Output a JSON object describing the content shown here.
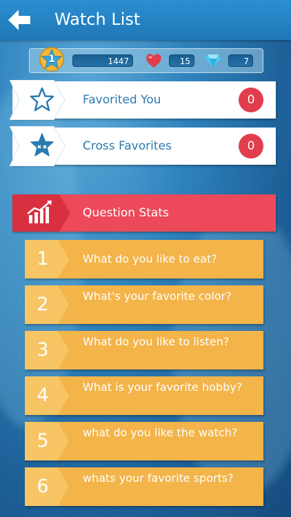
{
  "header": {
    "title": "Watch List"
  },
  "stats": {
    "level": "1",
    "points": "1447",
    "hearts": "15",
    "gems": "7"
  },
  "favorites": [
    {
      "label": "Favorited You",
      "count": "0",
      "icon": "star-outline-icon"
    },
    {
      "label": "Cross Favorites",
      "count": "0",
      "icon": "cross-star-icon"
    }
  ],
  "question_stats": {
    "label": "Question Stats",
    "icon": "chart-icon",
    "items": [
      {
        "num": "1",
        "text": "What do you like to eat?"
      },
      {
        "num": "2",
        "text": "What's your favorite color?"
      },
      {
        "num": "3",
        "text": "What do you like to listen?"
      },
      {
        "num": "4",
        "text": "What is your favorite hobby?"
      },
      {
        "num": "5",
        "text": "what do you like the watch?"
      },
      {
        "num": "6",
        "text": "whats your favorite sports?"
      }
    ]
  },
  "colors": {
    "header": "#2b8fd0",
    "accent_red": "#ec4a5a",
    "row_orange": "#f3b44a",
    "badge_red": "#e23d4d"
  }
}
